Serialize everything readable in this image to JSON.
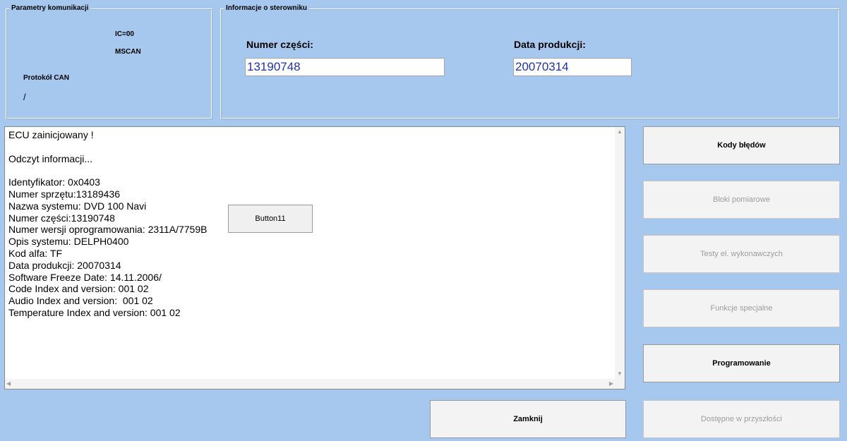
{
  "comm_params": {
    "title": "Parametry komunikacji",
    "ic": "IC=00",
    "bus": "MSCAN",
    "protocol_label": "Protokół CAN",
    "protocol_value": "/"
  },
  "controller_info": {
    "title": "Informacje o sterowniku",
    "part_number_label": "Numer części:",
    "part_number_value": "13190748",
    "production_date_label": "Data produkcji:",
    "production_date_value": "20070314"
  },
  "log": {
    "lines": [
      "ECU zainicjowany !",
      "",
      "Odczyt informacji...",
      "",
      "Identyfikator: 0x0403",
      "Numer sprzętu:13189436",
      "Nazwa systemu: DVD 100 Navi",
      "Numer części:13190748",
      "Numer wersji oprogramowania: 2311A/7759B",
      "Opis systemu: DELPH0400",
      "Kod alfa: TF",
      "Data produkcji: 20070314",
      "Software Freeze Date: 14.11.2006/",
      "Code Index and version: 001 02",
      "Audio Index and version:  001 02",
      "Temperature Index and version: 001 02"
    ]
  },
  "buttons": {
    "button11": "Button11",
    "error_codes": "Kody błędów",
    "measure_blocks": "Bloki pomiarowe",
    "actuator_tests": "Testy el. wykonawczych",
    "special_functions": "Funkcje specjalne",
    "programming": "Programowanie",
    "future": "Dostępne w przyszłości",
    "close": "Zamknij"
  },
  "colors": {
    "background": "#a7c8ee",
    "field_text": "#2233aa",
    "disabled_text": "#9c9c9c"
  }
}
